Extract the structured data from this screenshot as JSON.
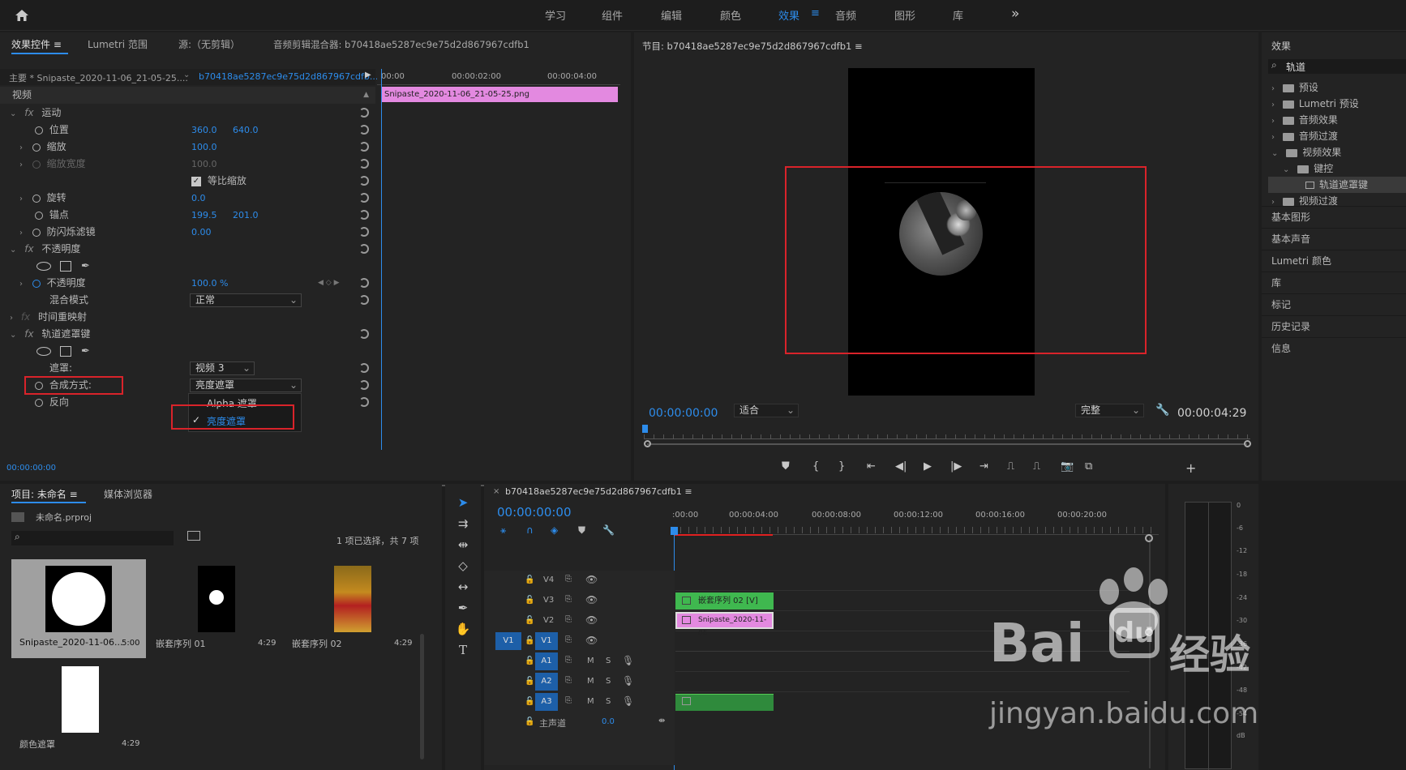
{
  "topbar": {
    "workspaces": [
      "学习",
      "组件",
      "编辑",
      "颜色",
      "效果",
      "音频",
      "图形",
      "库"
    ],
    "active": "效果",
    "more": "»"
  },
  "effect_controls": {
    "tabs": [
      "效果控件",
      "Lumetri 范围",
      "源:（无剪辑）",
      "音频剪辑混合器: b70418ae5287ec9e75d2d867967cdfb1"
    ],
    "master": "主要 * Snipaste_2020-11-06_21-05-25....",
    "sequence": "b70418ae5287ec9e75d2d867967cdfb...",
    "ruler": [
      "00:00",
      "00:00:02:00",
      "00:00:04:00"
    ],
    "clip_name": "Snipaste_2020-11-06_21-05-25.png",
    "section_video": "视频",
    "motion": "运动",
    "position": {
      "label": "位置",
      "x": "360.0",
      "y": "640.0"
    },
    "scale": {
      "label": "缩放",
      "value": "100.0"
    },
    "scale_width": {
      "label": "缩放宽度",
      "value": "100.0"
    },
    "uniform_scale": "等比缩放",
    "rotation": {
      "label": "旋转",
      "value": "0.0"
    },
    "anchor": {
      "label": "锚点",
      "x": "199.5",
      "y": "201.0"
    },
    "anti_flicker": {
      "label": "防闪烁滤镜",
      "value": "0.00"
    },
    "opacity_section": "不透明度",
    "opacity": {
      "label": "不透明度",
      "value": "100.0 %"
    },
    "blend": {
      "label": "混合模式",
      "value": "正常"
    },
    "time_remap": "时间重映射",
    "track_matte": "轨道遮罩键",
    "matte": {
      "label": "遮罩:",
      "value": "视频 3"
    },
    "composite": {
      "label": "合成方式:",
      "value": "亮度遮罩"
    },
    "reverse": "反向",
    "dropdown_options": [
      "Alpha 遮罩",
      "亮度遮罩"
    ],
    "dropdown_selected": "亮度遮罩",
    "timecode": "00:00:00:00"
  },
  "program": {
    "title": "节目: b70418ae5287ec9e75d2d867967cdfb1",
    "timecode": "00:00:00:00",
    "fit": "适合",
    "quality": "完整",
    "duration": "00:00:04:29"
  },
  "effects_panel": {
    "title": "效果",
    "search": "轨道",
    "tree": [
      {
        "label": "预设",
        "depth": 0,
        "open": false
      },
      {
        "label": "Lumetri 预设",
        "depth": 0,
        "open": false
      },
      {
        "label": "音频效果",
        "depth": 0,
        "open": false
      },
      {
        "label": "音频过渡",
        "depth": 0,
        "open": false
      },
      {
        "label": "视频效果",
        "depth": 0,
        "open": true
      },
      {
        "label": "键控",
        "depth": 1,
        "open": true
      },
      {
        "label": "轨道遮罩键",
        "depth": 2,
        "open": false
      },
      {
        "label": "视频过渡",
        "depth": 0,
        "open": false
      }
    ],
    "sections": [
      "基本图形",
      "基本声音",
      "Lumetri 颜色",
      "库",
      "标记",
      "历史记录",
      "信息"
    ]
  },
  "project": {
    "tabs": [
      "项目: 未命名",
      "媒体浏览器"
    ],
    "file": "未命名.prproj",
    "selection": "1 项已选择，共 7 项",
    "items": [
      {
        "name": "Snipaste_2020-11-06...",
        "duration": "5:00"
      },
      {
        "name": "嵌套序列 01",
        "duration": "4:29"
      },
      {
        "name": "嵌套序列 02",
        "duration": "4:29"
      },
      {
        "name": "颜色遮罩",
        "duration": "4:29"
      }
    ]
  },
  "timeline": {
    "title": "b70418ae5287ec9e75d2d867967cdfb1",
    "timecode": "00:00:00:00",
    "ruler": [
      ":00:00",
      "00:00:04:00",
      "00:00:08:00",
      "00:00:12:00",
      "00:00:16:00",
      "00:00:20:00"
    ],
    "tracks_video": [
      "V4",
      "V3",
      "V2",
      "V1"
    ],
    "tracks_audio": [
      "A1",
      "A2",
      "A3"
    ],
    "source_v": "V1",
    "master": "主声道",
    "master_value": "0.0",
    "clip_v3": "嵌套序列 02 [V]",
    "clip_v2": "Snipaste_2020-11-06",
    "audio_btn": [
      "M",
      "S"
    ]
  },
  "meter": {
    "labels": [
      "0",
      "-6",
      "-12",
      "-18",
      "-24",
      "-30",
      "-36",
      "-42",
      "-48",
      "-54",
      "dB"
    ]
  },
  "watermark": {
    "brand": "Bai",
    "brand2": "经验",
    "url": "jingyan.baidu.com"
  }
}
